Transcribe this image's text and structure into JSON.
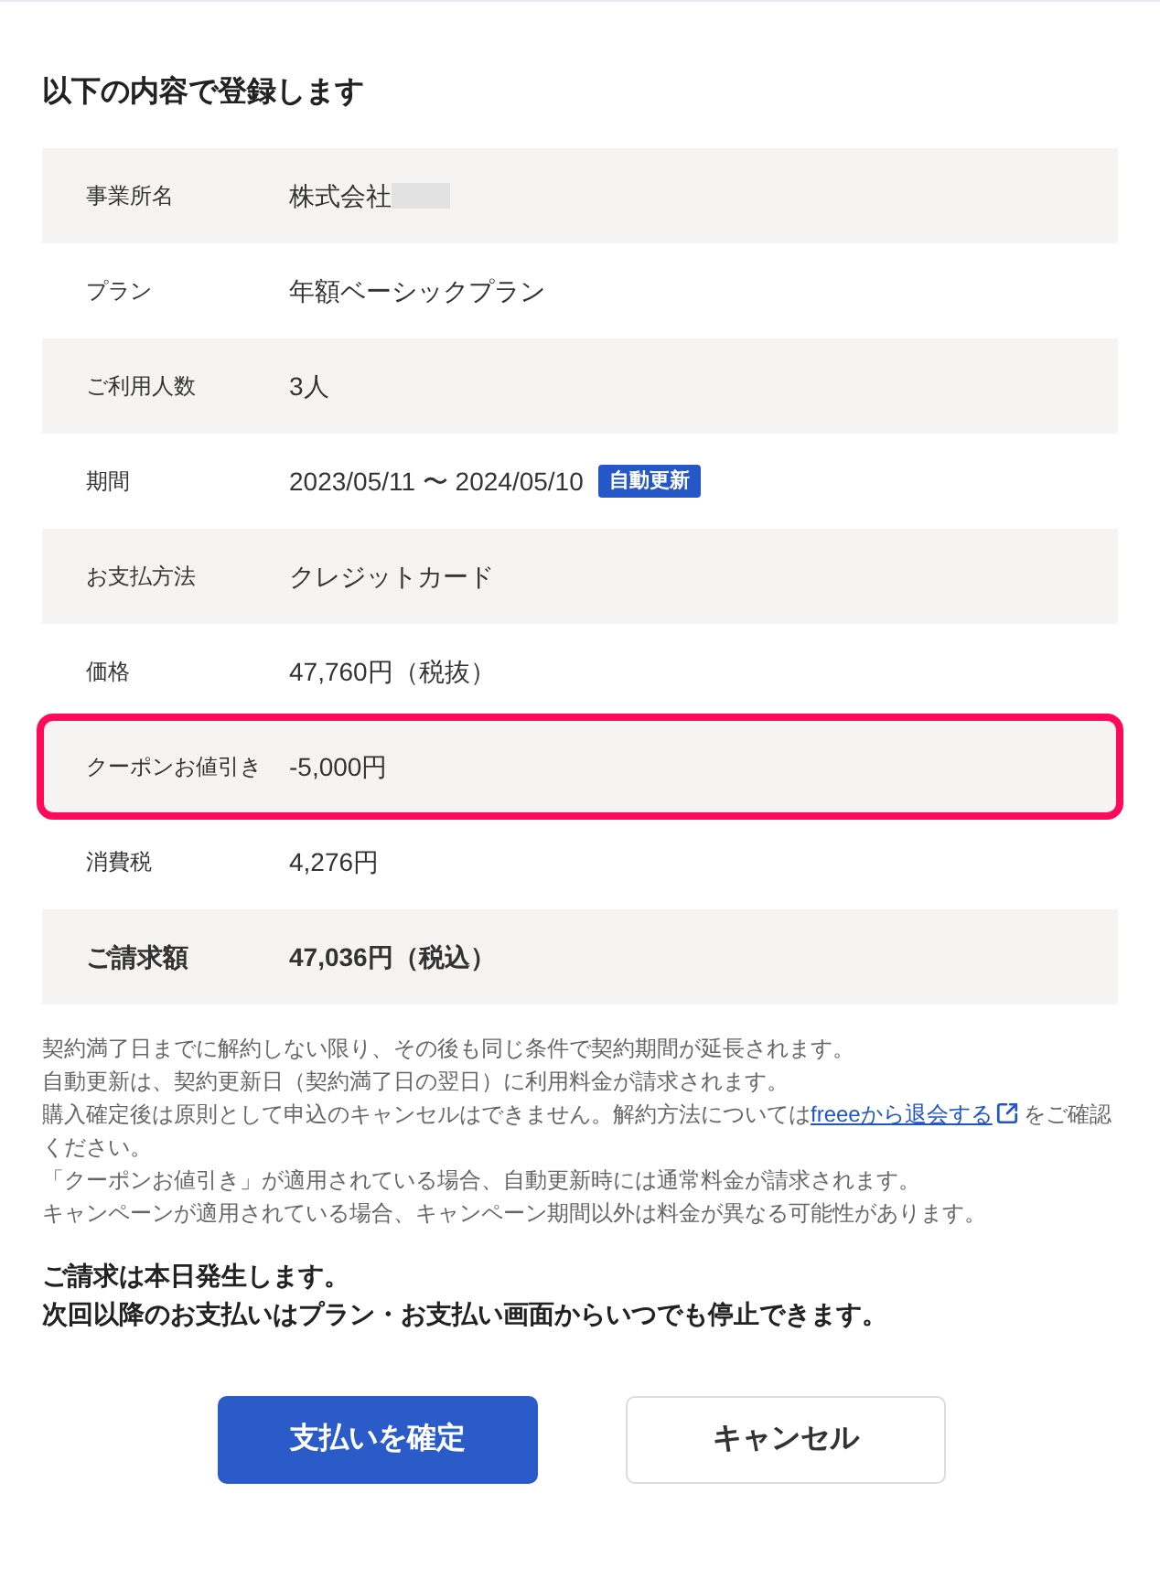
{
  "title": "以下の内容で登録します",
  "rows": [
    {
      "label": "事業所名",
      "value": "株式会社",
      "redacted": true,
      "kind": "item",
      "highlighted": false
    },
    {
      "label": "プラン",
      "value": "年額ベーシックプラン",
      "kind": "item",
      "highlighted": false
    },
    {
      "label": "ご利用人数",
      "value": "3人",
      "kind": "item",
      "highlighted": false
    },
    {
      "label": "期間",
      "value": "2023/05/11 〜 2024/05/10",
      "badge": "自動更新",
      "kind": "item",
      "highlighted": false
    },
    {
      "label": "お支払方法",
      "value": "クレジットカード",
      "kind": "item",
      "highlighted": false
    },
    {
      "label": "価格",
      "value": "47,760円（税抜）",
      "kind": "item",
      "highlighted": false
    },
    {
      "label": "クーポンお値引き",
      "value": "-5,000円",
      "kind": "item",
      "highlighted": true
    },
    {
      "label": "消費税",
      "value": "4,276円",
      "kind": "item",
      "highlighted": false
    },
    {
      "label": "ご請求額",
      "value": "47,036円（税込）",
      "kind": "total",
      "highlighted": false
    }
  ],
  "notes": [
    {
      "text": "契約満了日までに解約しない限り、その後も同じ条件で契約期間が延長されます。"
    },
    {
      "text": "自動更新は、契約更新日（契約満了日の翌日）に利用料金が請求されます。"
    },
    {
      "text": "購入確定後は原則として申込のキャンセルはできません。解約方法については",
      "link": "freeeから退会する",
      "text_after": "をご確認ください。"
    },
    {
      "text": "「クーポンお値引き」が適用されている場合、自動更新時には通常料金が請求されます。"
    },
    {
      "text": "キャンペーンが適用されている場合、キャンペーン期間以外は料金が異なる可能性があります。"
    }
  ],
  "notice": [
    "ご請求は本日発生します。",
    "次回以降のお支払いはプラン・お支払い画面からいつでも停止できます。"
  ],
  "buttons": [
    {
      "label": "支払いを確定",
      "kind": "primary"
    },
    {
      "label": "キャンセル",
      "kind": "secondary"
    }
  ]
}
